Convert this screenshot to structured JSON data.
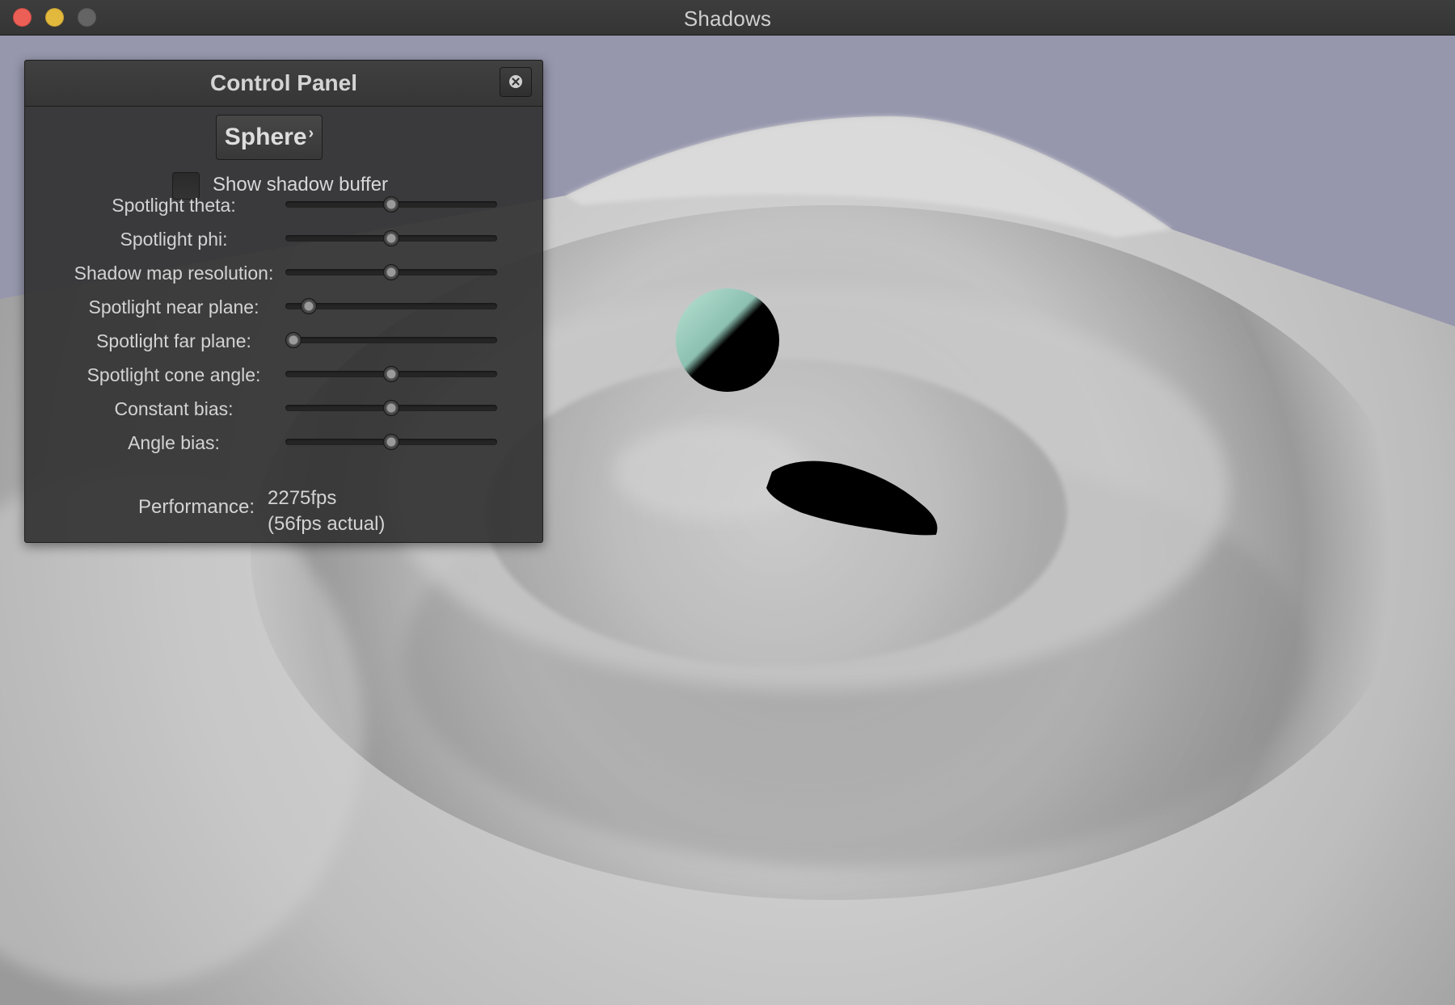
{
  "window": {
    "title": "Shadows"
  },
  "panel": {
    "title": "Control Panel",
    "model_button": {
      "label": "Sphere",
      "chevron": "›"
    },
    "show_shadow_buffer": {
      "label": "Show shadow buffer",
      "checked": false
    },
    "sliders": [
      {
        "label": "Spotlight theta:",
        "value": 0.5
      },
      {
        "label": "Spotlight phi:",
        "value": 0.5
      },
      {
        "label": "Shadow map resolution:",
        "value": 0.5
      },
      {
        "label": "Spotlight near plane:",
        "value": 0.08
      },
      {
        "label": "Spotlight far plane:",
        "value": 0.0
      },
      {
        "label": "Spotlight cone angle:",
        "value": 0.5
      },
      {
        "label": "Constant bias:",
        "value": 0.5
      },
      {
        "label": "Angle bias:",
        "value": 0.5
      }
    ],
    "performance": {
      "label": "Performance:",
      "fps": "2275fps",
      "actual": "(56fps actual)"
    }
  },
  "colors": {
    "sky": "#9697ad",
    "terrain": "#c8c8c8",
    "sphere_lit": "#a8d8c8",
    "shadow": "#000000"
  },
  "icons": {
    "close": "close-circle-icon",
    "chevron": "chevron-right-icon"
  }
}
